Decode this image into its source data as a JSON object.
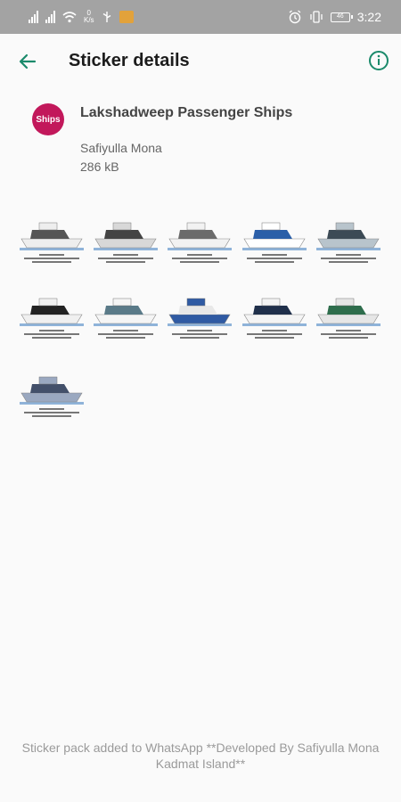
{
  "status_bar": {
    "net_speed_value": "0",
    "net_speed_unit": "K/s",
    "battery": "46",
    "time": "3:22"
  },
  "toolbar": {
    "title": "Sticker details",
    "back_icon": "arrow-back-icon",
    "info_icon": "info-icon"
  },
  "pack": {
    "avatar_text": "Ships",
    "name": "Lakshadweep Passenger Ships",
    "author": "Safiyulla Mona",
    "size": "286 kB"
  },
  "stickers": [
    {
      "id": 1,
      "hull": "#eeeeee",
      "deck": "#555555"
    },
    {
      "id": 2,
      "hull": "#d8d8d8",
      "deck": "#444444"
    },
    {
      "id": 3,
      "hull": "#f2f2f2",
      "deck": "#6b6b6b"
    },
    {
      "id": 4,
      "hull": "#ffffff",
      "deck": "#2b5fa8"
    },
    {
      "id": 5,
      "hull": "#b8c4cc",
      "deck": "#3c4a55"
    },
    {
      "id": 6,
      "hull": "#f0f0f0",
      "deck": "#222222"
    },
    {
      "id": 7,
      "hull": "#f5f5f5",
      "deck": "#5a7a88"
    },
    {
      "id": 8,
      "hull": "#2f5aa3",
      "deck": "#e8e8e8"
    },
    {
      "id": 9,
      "hull": "#f4f4f4",
      "deck": "#1f2f4a"
    },
    {
      "id": 10,
      "hull": "#e6e6e6",
      "deck": "#2e6d4c"
    },
    {
      "id": 11,
      "hull": "#9aa8c0",
      "deck": "#43506a"
    }
  ],
  "footer": {
    "message": "Sticker pack added to WhatsApp **Developed By Safiyulla Mona Kadmat Island**"
  },
  "colors": {
    "accent": "#1b8a6b",
    "avatar_bg": "#c2185b",
    "status_bar": "#a3a3a3"
  }
}
